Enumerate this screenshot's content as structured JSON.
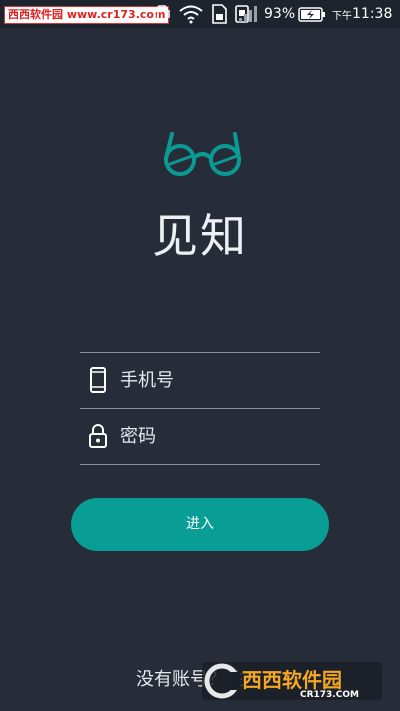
{
  "status_bar": {
    "watermark": "西西软件园 www.cr173.com",
    "battery": "93%",
    "time_prefix": "下午",
    "time": "11:38"
  },
  "app": {
    "title": "见知",
    "logo_icon": "glasses-icon",
    "accent_color": "#089e96"
  },
  "form": {
    "phone_placeholder": "手机号",
    "phone_icon": "phone-icon",
    "password_placeholder": "密码",
    "password_icon": "lock-icon",
    "enter_label": "进入"
  },
  "footer": {
    "register_text": "没有账号？注"
  },
  "watermark_bottom": {
    "brand": "西西软件园",
    "site": "CR173.COM"
  }
}
